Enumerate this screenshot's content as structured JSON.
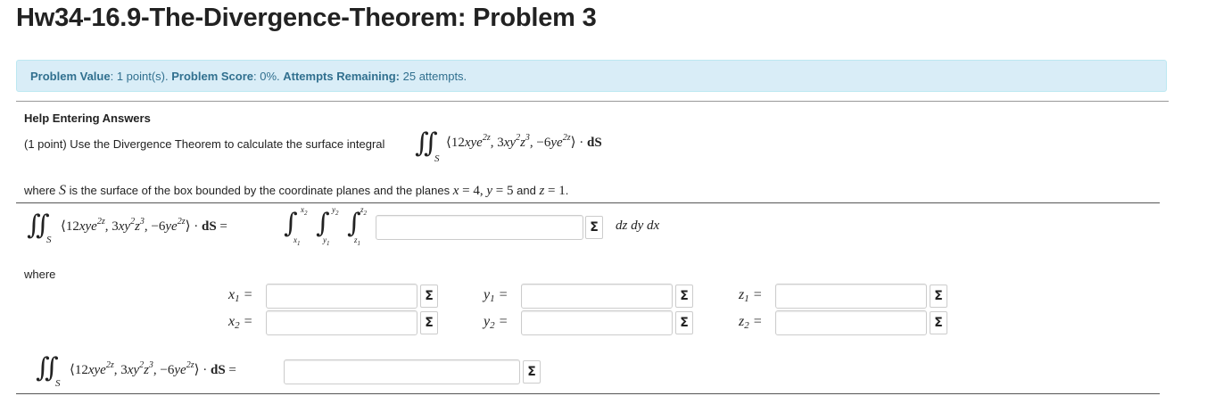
{
  "page_title": "Hw34-16.9-The-Divergence-Theorem: Problem 3",
  "info": {
    "value_label": "Problem Value",
    "value_text": ": 1 point(s).",
    "score_label": "Problem Score",
    "score_text": ": 0%.",
    "attempts_label": "Attempts Remaining:",
    "attempts_text": "25 attempts."
  },
  "help_link": "Help Entering Answers",
  "problem": {
    "intro": "(1 point) Use the Divergence Theorem to calculate the surface integral",
    "where_prefix": "where",
    "where_mid": "is the surface of the box bounded by the coordinate planes and the planes",
    "and_word": "and",
    "where_label": "where",
    "x_value": "4",
    "y_value": "5",
    "z_value": "1"
  },
  "math": {
    "field": "⟨12xye²ᶻ, 3xy²z³, −6ye²ᶻ⟩ · dS",
    "surface": "S",
    "differentials": "dz dy dx"
  },
  "inputs": {
    "triple_integral": "",
    "x1": "",
    "x2": "",
    "y1": "",
    "y2": "",
    "z1": "",
    "z2": "",
    "final": ""
  },
  "equation_button_label": "Σ",
  "var_labels": {
    "x1": "x",
    "x2": "x",
    "y1": "y",
    "y2": "y",
    "z1": "z",
    "z2": "z",
    "sub1": "1",
    "sub2": "2"
  }
}
